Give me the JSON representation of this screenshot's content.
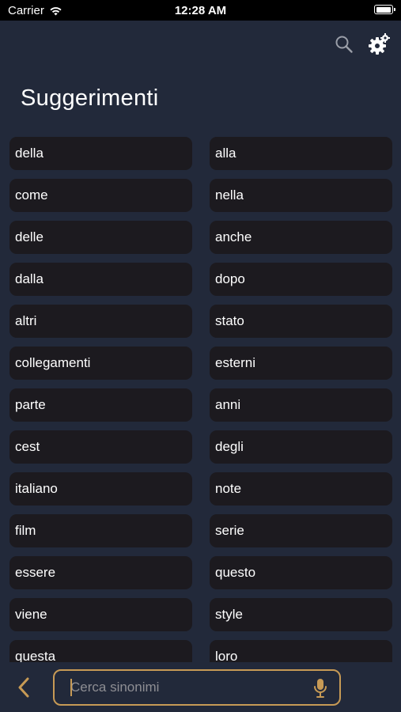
{
  "status_bar": {
    "carrier": "Carrier",
    "time": "12:28 AM",
    "battery_level": 1.0
  },
  "header": {
    "search_icon": "search-icon",
    "settings_icon": "gear-icon"
  },
  "title": "Suggerimenti",
  "suggestions": [
    [
      "della",
      "alla"
    ],
    [
      "come",
      "nella"
    ],
    [
      "delle",
      "anche"
    ],
    [
      "dalla",
      "dopo"
    ],
    [
      "altri",
      "stato"
    ],
    [
      "collegamenti",
      "esterni"
    ],
    [
      "parte",
      "anni"
    ],
    [
      "cest",
      "degli"
    ],
    [
      "italiano",
      "note"
    ],
    [
      "film",
      "serie"
    ],
    [
      "essere",
      "questo"
    ],
    [
      "viene",
      "style"
    ],
    [
      "questa",
      "loro"
    ]
  ],
  "bottom_bar": {
    "back_icon": "chevron-left-icon",
    "search_placeholder": "Cerca sinonimi",
    "search_value": "",
    "mic_icon": "microphone-icon"
  },
  "colors": {
    "background": "#22293a",
    "chip": "#1c1a1f",
    "accent": "#c79a55",
    "status_bar": "#000000"
  }
}
